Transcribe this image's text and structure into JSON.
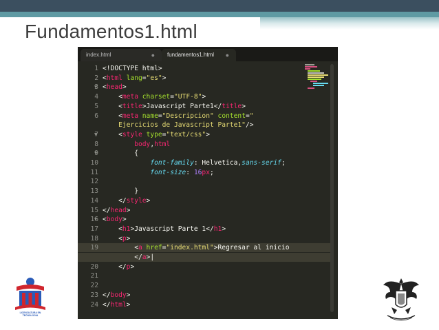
{
  "slide": {
    "title": "Fundamentos1.html"
  },
  "editor": {
    "tabs": [
      {
        "label": "index.html",
        "active": false,
        "dot": "●"
      },
      {
        "label": "fundamentos1.html",
        "active": true,
        "dot": "●"
      }
    ],
    "lines": [
      {
        "n": "1",
        "fold": "",
        "segs": [
          [
            "",
            "<!DOCTYPE html>"
          ]
        ]
      },
      {
        "n": "2",
        "fold": "",
        "segs": [
          [
            "",
            "<"
          ],
          [
            "t",
            "html"
          ],
          [
            "",
            " "
          ],
          [
            "a",
            "lang"
          ],
          [
            "",
            "="
          ],
          [
            "s",
            "\"es\""
          ],
          [
            "",
            ">"
          ]
        ]
      },
      {
        "n": "3",
        "fold": "▼",
        "segs": [
          [
            "",
            "<"
          ],
          [
            "t",
            "head"
          ],
          [
            "",
            ">"
          ]
        ]
      },
      {
        "n": "4",
        "fold": "",
        "segs": [
          [
            "",
            "    <"
          ],
          [
            "t",
            "meta"
          ],
          [
            "",
            " "
          ],
          [
            "a",
            "charset"
          ],
          [
            "",
            "="
          ],
          [
            "s",
            "\"UTF-8\""
          ],
          [
            "",
            ">"
          ]
        ]
      },
      {
        "n": "5",
        "fold": "",
        "segs": [
          [
            "",
            "    <"
          ],
          [
            "t",
            "title"
          ],
          [
            "",
            ">Javascript Parte1</"
          ],
          [
            "t",
            "title"
          ],
          [
            "",
            ">"
          ]
        ]
      },
      {
        "n": "6",
        "fold": "",
        "segs": [
          [
            "",
            "    <"
          ],
          [
            "t",
            "meta"
          ],
          [
            "",
            " "
          ],
          [
            "a",
            "name"
          ],
          [
            "",
            "="
          ],
          [
            "s",
            "\"Descripcion\""
          ],
          [
            "",
            " "
          ],
          [
            "a",
            "content"
          ],
          [
            "",
            "="
          ],
          [
            "s",
            "\""
          ]
        ]
      },
      {
        "n": "",
        "fold": "",
        "segs": [
          [
            "s",
            "    Ejercicios de Javascript Parte1\""
          ],
          [
            "",
            "/>"
          ]
        ]
      },
      {
        "n": "7",
        "fold": "▼",
        "segs": [
          [
            "",
            "    <"
          ],
          [
            "t",
            "style"
          ],
          [
            "",
            " "
          ],
          [
            "a",
            "type"
          ],
          [
            "",
            "="
          ],
          [
            "s",
            "\"text/css\""
          ],
          [
            "",
            ">"
          ]
        ]
      },
      {
        "n": "8",
        "fold": "",
        "segs": [
          [
            "",
            "        "
          ],
          [
            "t",
            "body"
          ],
          [
            "",
            ","
          ],
          [
            "t",
            "html"
          ]
        ]
      },
      {
        "n": "9",
        "fold": "▼",
        "segs": [
          [
            "",
            "        {"
          ]
        ]
      },
      {
        "n": "10",
        "fold": "",
        "segs": [
          [
            "",
            "            "
          ],
          [
            "p",
            "font-family"
          ],
          [
            "",
            ": Helvetica,"
          ],
          [
            "p",
            "sans-serif"
          ],
          [
            "",
            ";"
          ]
        ]
      },
      {
        "n": "11",
        "fold": "",
        "segs": [
          [
            "",
            "            "
          ],
          [
            "p",
            "font-size"
          ],
          [
            "",
            ": "
          ],
          [
            "n",
            "16"
          ],
          [
            "t",
            "px"
          ],
          [
            "",
            ";"
          ]
        ]
      },
      {
        "n": "12",
        "fold": "",
        "segs": [
          [
            "",
            ""
          ]
        ]
      },
      {
        "n": "13",
        "fold": "",
        "segs": [
          [
            "",
            "        }"
          ]
        ]
      },
      {
        "n": "14",
        "fold": "",
        "segs": [
          [
            "",
            "    </"
          ],
          [
            "t",
            "style"
          ],
          [
            "",
            ">"
          ]
        ]
      },
      {
        "n": "15",
        "fold": "",
        "segs": [
          [
            "",
            "</"
          ],
          [
            "t",
            "head"
          ],
          [
            "",
            ">"
          ]
        ]
      },
      {
        "n": "16",
        "fold": "▼",
        "segs": [
          [
            "",
            "<"
          ],
          [
            "t",
            "body"
          ],
          [
            "",
            ">"
          ]
        ]
      },
      {
        "n": "17",
        "fold": "",
        "segs": [
          [
            "",
            "    <"
          ],
          [
            "t",
            "h1"
          ],
          [
            "",
            ">Javascript Parte 1</"
          ],
          [
            "t",
            "h1"
          ],
          [
            "",
            ">"
          ]
        ]
      },
      {
        "n": "18",
        "fold": "",
        "segs": [
          [
            "",
            "    <"
          ],
          [
            "t",
            "p"
          ],
          [
            "",
            ">"
          ]
        ]
      },
      {
        "n": "19",
        "fold": "",
        "segs": [
          [
            "",
            "        <"
          ],
          [
            "t",
            "a"
          ],
          [
            "",
            " "
          ],
          [
            "a",
            "href"
          ],
          [
            "",
            "="
          ],
          [
            "s",
            "\"index.html\""
          ],
          [
            "",
            ">Regresar al inicio"
          ]
        ],
        "highlight": true
      },
      {
        "n": "",
        "fold": "",
        "segs": [
          [
            "",
            "        </"
          ],
          [
            "t",
            "a"
          ],
          [
            "",
            ">|"
          ]
        ],
        "highlight": true
      },
      {
        "n": "20",
        "fold": "",
        "segs": [
          [
            "",
            "    </"
          ],
          [
            "t",
            "p"
          ],
          [
            "",
            ">"
          ]
        ]
      },
      {
        "n": "21",
        "fold": "",
        "segs": [
          [
            "",
            ""
          ]
        ]
      },
      {
        "n": "22",
        "fold": "",
        "segs": [
          [
            "",
            ""
          ]
        ]
      },
      {
        "n": "23",
        "fold": "",
        "segs": [
          [
            "",
            "</"
          ],
          [
            "t",
            "body"
          ],
          [
            "",
            ">"
          ]
        ]
      },
      {
        "n": "24",
        "fold": "",
        "segs": [
          [
            "",
            "</"
          ],
          [
            "t",
            "html"
          ],
          [
            "",
            ">"
          ]
        ]
      }
    ]
  },
  "logos": {
    "left": {
      "icon": "university-logo-icon",
      "caption": "LICENCIATURA EN TECNOLOGIA"
    },
    "right": {
      "icon": "eagle-crest-icon"
    }
  },
  "colors": {
    "editor_bg": "#272822",
    "tag": "#f92672",
    "attr": "#a6e22e",
    "string": "#e6db74",
    "property": "#66d9ef",
    "number": "#ae81ff"
  }
}
